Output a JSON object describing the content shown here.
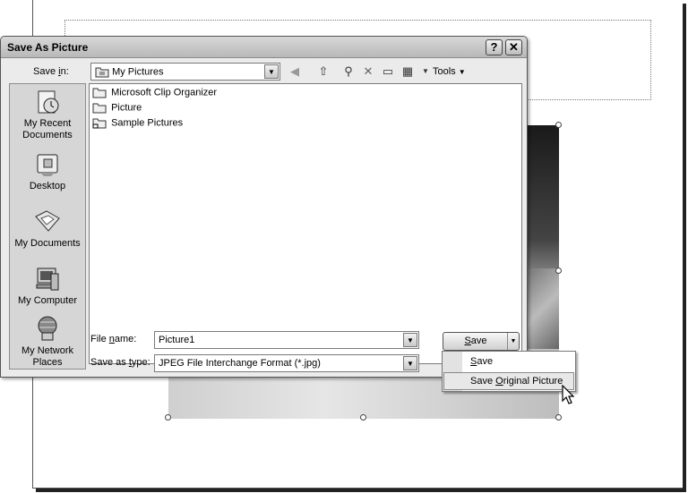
{
  "dialog": {
    "title": "Save As Picture",
    "help_button": "?",
    "close_button": "✕"
  },
  "save_in": {
    "label": "Save in:",
    "value": "My Pictures",
    "tools_label": "Tools"
  },
  "places": [
    {
      "label": "My Recent Documents",
      "icon": "recent-documents-icon"
    },
    {
      "label": "Desktop",
      "icon": "desktop-icon"
    },
    {
      "label": "My Documents",
      "icon": "my-documents-icon"
    },
    {
      "label": "My Computer",
      "icon": "my-computer-icon"
    },
    {
      "label": "My Network Places",
      "icon": "network-places-icon"
    }
  ],
  "files": [
    {
      "name": "Microsoft Clip Organizer",
      "icon": "folder-icon"
    },
    {
      "name": "Picture",
      "icon": "folder-icon"
    },
    {
      "name": "Sample Pictures",
      "icon": "shortcut-folder-icon"
    }
  ],
  "file_name": {
    "label": "File name:",
    "value": "Picture1"
  },
  "save_as_type": {
    "label": "Save as type:",
    "value": "JPEG File Interchange Format (*.jpg)"
  },
  "save_button": {
    "label": "Save"
  },
  "save_menu": [
    {
      "label": "Save"
    },
    {
      "label": "Save Original Picture"
    }
  ]
}
